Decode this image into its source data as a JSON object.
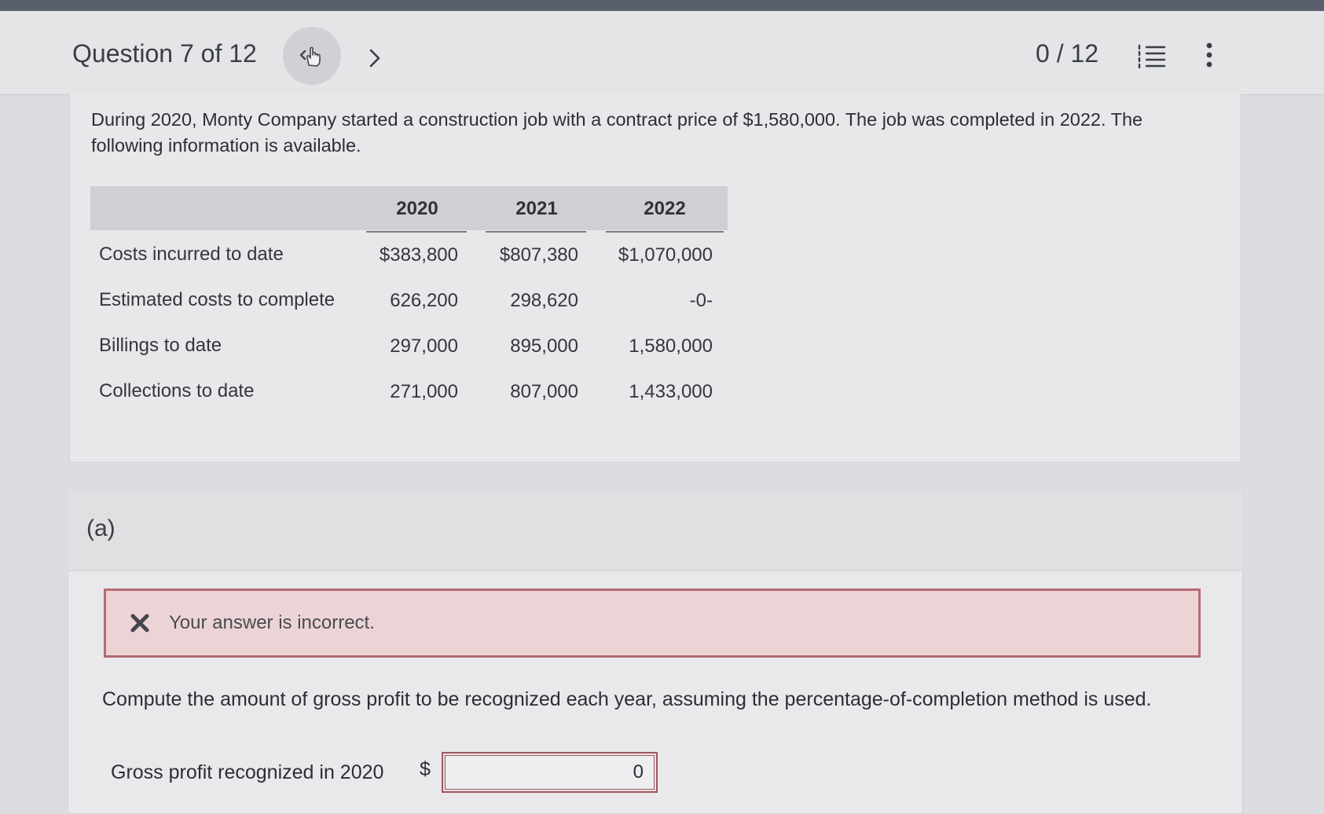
{
  "header": {
    "question_title": "Question 7 of 12",
    "score": "0 / 12"
  },
  "problem": {
    "intro": "During 2020, Monty Company started a construction job with a contract price of $1,580,000. The job was completed in 2022. The following information is available.",
    "table": {
      "columns": [
        "2020",
        "2021",
        "2022"
      ],
      "rows": [
        {
          "label": "Costs incurred to date",
          "values": [
            "$383,800",
            "$807,380",
            "$1,070,000"
          ]
        },
        {
          "label": "Estimated costs to complete",
          "values": [
            "626,200",
            "298,620",
            "-0-"
          ]
        },
        {
          "label": "Billings to date",
          "values": [
            "297,000",
            "895,000",
            "1,580,000"
          ]
        },
        {
          "label": "Collections to date",
          "values": [
            "271,000",
            "807,000",
            "1,433,000"
          ]
        }
      ]
    }
  },
  "part_a": {
    "label": "(a)",
    "alert_text": "Your answer is incorrect.",
    "prompt": "Compute the amount of gross profit to be recognized each year, assuming the percentage-of-completion method is used.",
    "field_label": "Gross profit recognized in 2020",
    "currency": "$",
    "field_value": "0"
  },
  "colors": {
    "error_border": "#b66a70",
    "error_bg": "#ecd4d6",
    "header_band": "#cfd0d3"
  },
  "icons": [
    "chevron-left-icon",
    "hand-pointer-icon",
    "chevron-right-icon",
    "list-icon",
    "more-vertical-icon",
    "x-icon"
  ]
}
